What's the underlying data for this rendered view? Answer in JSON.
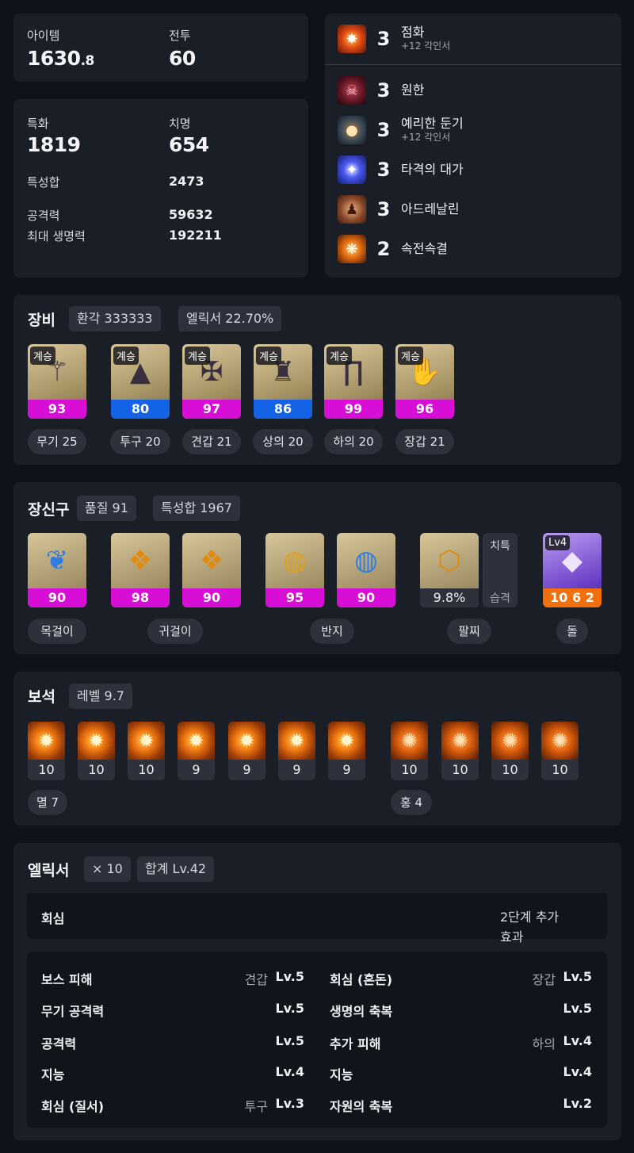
{
  "stats_top": {
    "item_label": "아이템",
    "item_value": "1630",
    "item_decimal": ".8",
    "combat_label": "전투",
    "combat_value": "60"
  },
  "stats_main": {
    "spec_label": "특화",
    "spec_value": "1819",
    "crit_label": "치명",
    "crit_value": "654",
    "total_label": "특성합",
    "total_value": "2473",
    "atk_label": "공격력",
    "atk_value": "59632",
    "hp_label": "최대 생명력",
    "hp_value": "192211"
  },
  "engravings": [
    {
      "level": "3",
      "name": "점화",
      "sub": "+12 각인서",
      "icon": "ignite-icon",
      "color": "#c4301a"
    },
    {
      "level": "3",
      "name": "원한",
      "sub": "",
      "icon": "grudge-icon",
      "color": "#7a1f2a"
    },
    {
      "level": "3",
      "name": "예리한 둔기",
      "sub": "+12 각인서",
      "icon": "keen-blunt-icon",
      "color": "#2b4a5c"
    },
    {
      "level": "3",
      "name": "타격의 대가",
      "sub": "",
      "icon": "hit-master-icon",
      "color": "#3a3fd0"
    },
    {
      "level": "3",
      "name": "아드레날린",
      "sub": "",
      "icon": "adrenaline-icon",
      "color": "#8a4a2a"
    },
    {
      "level": "2",
      "name": "속전속결",
      "sub": "",
      "icon": "spirit-absorption-icon",
      "color": "#c45a10"
    }
  ],
  "equipment": {
    "title": "장비",
    "chip_transcend": "환각 333333",
    "chip_elixir": "엘릭서 22.70%",
    "items": [
      {
        "tag": "계승",
        "quality": "93",
        "quality_color": "magenta",
        "label": "무기 25",
        "icon": "weapon-icon"
      },
      {
        "tag": "계승",
        "quality": "80",
        "quality_color": "blue",
        "label": "투구 20",
        "icon": "helmet-icon"
      },
      {
        "tag": "계승",
        "quality": "97",
        "quality_color": "magenta",
        "label": "견갑 21",
        "icon": "shoulder-icon"
      },
      {
        "tag": "계승",
        "quality": "86",
        "quality_color": "blue",
        "label": "상의 20",
        "icon": "chest-icon"
      },
      {
        "tag": "계승",
        "quality": "99",
        "quality_color": "magenta",
        "label": "하의 20",
        "icon": "pants-icon"
      },
      {
        "tag": "계승",
        "quality": "96",
        "quality_color": "magenta",
        "label": "장갑 21",
        "icon": "gloves-icon"
      }
    ]
  },
  "accessories": {
    "title": "장신구",
    "chip_quality": "품질 91",
    "chip_total": "특성합 1967",
    "items": [
      {
        "quality": "90",
        "icon": "necklace-icon"
      },
      {
        "quality": "98",
        "icon": "earring-icon"
      },
      {
        "quality": "90",
        "icon": "earring-icon"
      },
      {
        "quality": "95",
        "icon": "ring-icon"
      },
      {
        "quality": "90",
        "icon": "ring-icon"
      }
    ],
    "bracelet": {
      "value": "9.8%",
      "stat1": "치특",
      "stat2": "습격",
      "icon": "bracelet-icon"
    },
    "stone": {
      "level": "Lv4",
      "value": "10 6 2",
      "icon": "ability-stone-icon"
    },
    "labels": {
      "necklace": "목걸이",
      "earring": "귀걸이",
      "ring": "반지",
      "bracelet": "팔찌",
      "stone": "돌"
    }
  },
  "gems": {
    "title": "보석",
    "chip_level": "레벨 9.7",
    "annihilation": [
      "10",
      "10",
      "10",
      "9",
      "9",
      "9",
      "9"
    ],
    "crimson": [
      "10",
      "10",
      "10",
      "10"
    ],
    "label_annihilation": "멸 7",
    "label_crimson": "홍 4"
  },
  "elixir": {
    "title": "엘릭서",
    "chip_count": "× 10",
    "chip_total": "합계 Lv.42",
    "set_name": "회심",
    "set_effect_line1": "2단계 추가",
    "set_effect_line2": "효과",
    "rows": [
      {
        "left_name": "보스 피해",
        "left_slot": "견갑",
        "left_lv": "Lv.5",
        "right_name": "회심 (혼돈)",
        "right_slot": "장갑",
        "right_lv": "Lv.5"
      },
      {
        "left_name": "무기 공격력",
        "left_slot": "",
        "left_lv": "Lv.5",
        "right_name": "생명의 축복",
        "right_slot": "",
        "right_lv": "Lv.5"
      },
      {
        "left_name": "공격력",
        "left_slot": "",
        "left_lv": "Lv.5",
        "right_name": "추가 피해",
        "right_slot": "하의",
        "right_lv": "Lv.4"
      },
      {
        "left_name": "지능",
        "left_slot": "",
        "left_lv": "Lv.4",
        "right_name": "지능",
        "right_slot": "",
        "right_lv": "Lv.4"
      },
      {
        "left_name": "회심 (질서)",
        "left_slot": "투구",
        "left_lv": "Lv.3",
        "right_name": "자원의 축복",
        "right_slot": "",
        "right_lv": "Lv.2"
      }
    ]
  }
}
